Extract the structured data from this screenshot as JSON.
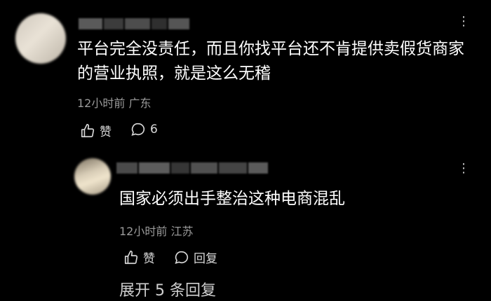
{
  "comment1": {
    "text_line1": "平台完全没责任，而且你找平台还不肯提供卖假货商家",
    "text_line2": "的营业执照，就是这么无稽",
    "meta": "12小时前 广东",
    "like_label": "赞",
    "reply_count": "6",
    "more_icon": "more-dots-icon"
  },
  "reply1": {
    "text": "国家必须出手整治这种电商混乱",
    "meta": "12小时前 江苏",
    "like_label": "赞",
    "reply_label": "回复",
    "more_icon": "more-dots-icon"
  },
  "footer": {
    "partial_text": "展开 5 条回复"
  }
}
